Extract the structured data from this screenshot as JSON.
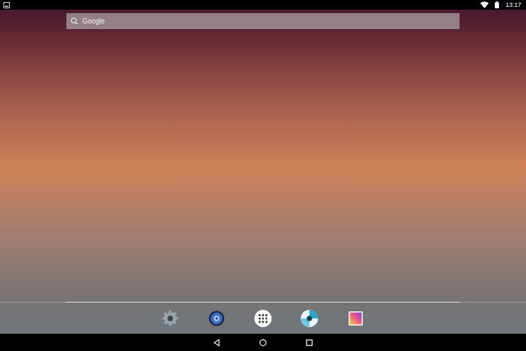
{
  "status_bar": {
    "time": "13:17",
    "icons": [
      {
        "kind": "notification"
      },
      {
        "kind": "wifi"
      },
      {
        "kind": "battery"
      }
    ]
  },
  "search": {
    "placeholder": "Google"
  },
  "dock": {
    "apps": [
      {
        "kind": "settings"
      },
      {
        "kind": "music"
      },
      {
        "kind": "apps"
      },
      {
        "kind": "browser"
      },
      {
        "kind": "gallery"
      }
    ]
  },
  "nav_bar": {
    "buttons": [
      {
        "kind": "back"
      },
      {
        "kind": "home"
      },
      {
        "kind": "recents"
      }
    ]
  }
}
